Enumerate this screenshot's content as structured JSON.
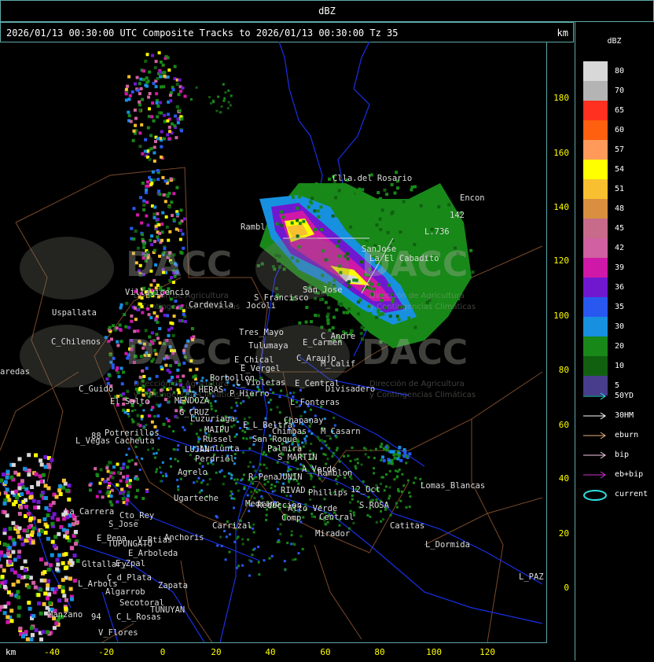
{
  "top_title": "dBZ",
  "header": {
    "title": "2026/01/13 00:30:00 UTC Composite Tracks to 2026/01/13 00:30:00 Tz 35",
    "unit": "km"
  },
  "axes": {
    "x_unit": "km",
    "x_ticks": [
      "-40",
      "-20",
      "0",
      "20",
      "40",
      "60",
      "80",
      "100",
      "120"
    ],
    "y_ticks": [
      "180",
      "160",
      "140",
      "120",
      "100",
      "80",
      "60",
      "40",
      "20",
      "0"
    ]
  },
  "legend": {
    "title": "dBZ",
    "levels": [
      {
        "value": "80",
        "color": "#d8d8d8"
      },
      {
        "value": "70",
        "color": "#b4b4b4"
      },
      {
        "value": "65",
        "color": "#ff3020"
      },
      {
        "value": "60",
        "color": "#ff6010"
      },
      {
        "value": "57",
        "color": "#ff9a5a"
      },
      {
        "value": "54",
        "color": "#ffff00"
      },
      {
        "value": "51",
        "color": "#f8c030"
      },
      {
        "value": "48",
        "color": "#d89040"
      },
      {
        "value": "45",
        "color": "#c86a8a"
      },
      {
        "value": "42",
        "color": "#d060a0"
      },
      {
        "value": "39",
        "color": "#d018a8"
      },
      {
        "value": "36",
        "color": "#7018d0"
      },
      {
        "value": "35",
        "color": "#2858f0"
      },
      {
        "value": "30",
        "color": "#1890e0"
      },
      {
        "value": "20",
        "color": "#188818"
      },
      {
        "value": "10",
        "color": "#106010"
      },
      {
        "value": "5",
        "color": "#483c8c"
      }
    ],
    "tracks": [
      {
        "label": "50YD",
        "color": "#30e0e0"
      },
      {
        "label": "30HM",
        "color": "#ffffff"
      },
      {
        "label": "eburn",
        "color": "#e8b080"
      },
      {
        "label": "bip",
        "color": "#f8c8e8"
      },
      {
        "label": "eb+bip",
        "color": "#d030d0"
      },
      {
        "label": "current",
        "color": "#30e0e0"
      }
    ]
  },
  "watermark": {
    "brand": "DACC",
    "line1": "Dirección de Agricultura",
    "line2": "y Contingencias Climáticas"
  },
  "cities": [
    {
      "name": "Clla.del Rosario"
    },
    {
      "name": "Encon"
    },
    {
      "name": "142"
    },
    {
      "name": "L.736"
    },
    {
      "name": "Rambl"
    },
    {
      "name": "SanJose"
    },
    {
      "name": "La El Cabadito"
    },
    {
      "name": "San Jose"
    },
    {
      "name": "Uspallata"
    },
    {
      "name": "Villavicencio"
    },
    {
      "name": "Cardevila"
    },
    {
      "name": "S_Francisco"
    },
    {
      "name": "Jocoli"
    },
    {
      "name": "C_Chilenos"
    },
    {
      "name": "Tres_Mayo"
    },
    {
      "name": "Tulumaya"
    },
    {
      "name": "C_Andre"
    },
    {
      "name": "E_Carmen"
    },
    {
      "name": "aredas"
    },
    {
      "name": "E_Chical"
    },
    {
      "name": "E_Vergel"
    },
    {
      "name": "C_Araujo"
    },
    {
      "name": "M_Calif"
    },
    {
      "name": "Borbollon"
    },
    {
      "name": "L_Violetas"
    },
    {
      "name": "E_Central"
    },
    {
      "name": "Divisadero"
    },
    {
      "name": "C_Guido"
    },
    {
      "name": "L_HERAS"
    },
    {
      "name": "P_Hierro"
    },
    {
      "name": "El Salto"
    },
    {
      "name": "MENDOZA"
    },
    {
      "name": "L_Fonteras"
    },
    {
      "name": "G_CRUZ"
    },
    {
      "name": "Chapanay"
    },
    {
      "name": "Luzuriaga"
    },
    {
      "name": "E_L_Beltra"
    },
    {
      "name": "Potrerillos"
    },
    {
      "name": "MAIPU"
    },
    {
      "name": "Chimbas"
    },
    {
      "name": "M_Casarn"
    },
    {
      "name": "L_Vegas"
    },
    {
      "name": "Cacheuta"
    },
    {
      "name": "Russel"
    },
    {
      "name": "San Roque"
    },
    {
      "name": "LUJAN"
    },
    {
      "name": "Lunlunta"
    },
    {
      "name": "Palmira"
    },
    {
      "name": "Perdriel"
    },
    {
      "name": "S_MARTIN"
    },
    {
      "name": "A_Verde"
    },
    {
      "name": "Agrelo"
    },
    {
      "name": "R_Pena"
    },
    {
      "name": "JUNIN"
    },
    {
      "name": "Ramblon"
    },
    {
      "name": "Lomas_Blancas"
    },
    {
      "name": "Ugarteche"
    },
    {
      "name": "RIVAD"
    },
    {
      "name": "Phillips"
    },
    {
      "name": "12_Oct"
    },
    {
      "name": "La_Carrera"
    },
    {
      "name": "Cto_Rey"
    },
    {
      "name": "Medrano"
    },
    {
      "name": "Reduccion"
    },
    {
      "name": "S.ROSA"
    },
    {
      "name": "S_Jose"
    },
    {
      "name": "Carrizal"
    },
    {
      "name": "Alto Verde"
    },
    {
      "name": "Comp"
    },
    {
      "name": "Central"
    },
    {
      "name": "Catitas"
    },
    {
      "name": "E_Pena"
    },
    {
      "name": "Anchoris"
    },
    {
      "name": "V_Btias"
    },
    {
      "name": "TUPUNGATO"
    },
    {
      "name": "Mirador"
    },
    {
      "name": "L_Dormida"
    },
    {
      "name": "E_Arboleda"
    },
    {
      "name": "Gltallary"
    },
    {
      "name": "E_Zpal"
    },
    {
      "name": "L_PAZ"
    },
    {
      "name": "L_Arbols"
    },
    {
      "name": "C_d_Plata"
    },
    {
      "name": "Zapata"
    },
    {
      "name": "Algarrob"
    },
    {
      "name": "Secotoral"
    },
    {
      "name": "Manzano"
    },
    {
      "name": "C_L_Rosas"
    },
    {
      "name": "TUNUYAN"
    },
    {
      "name": "V_Flores"
    },
    {
      "name": "88"
    },
    {
      "name": "94"
    }
  ]
}
